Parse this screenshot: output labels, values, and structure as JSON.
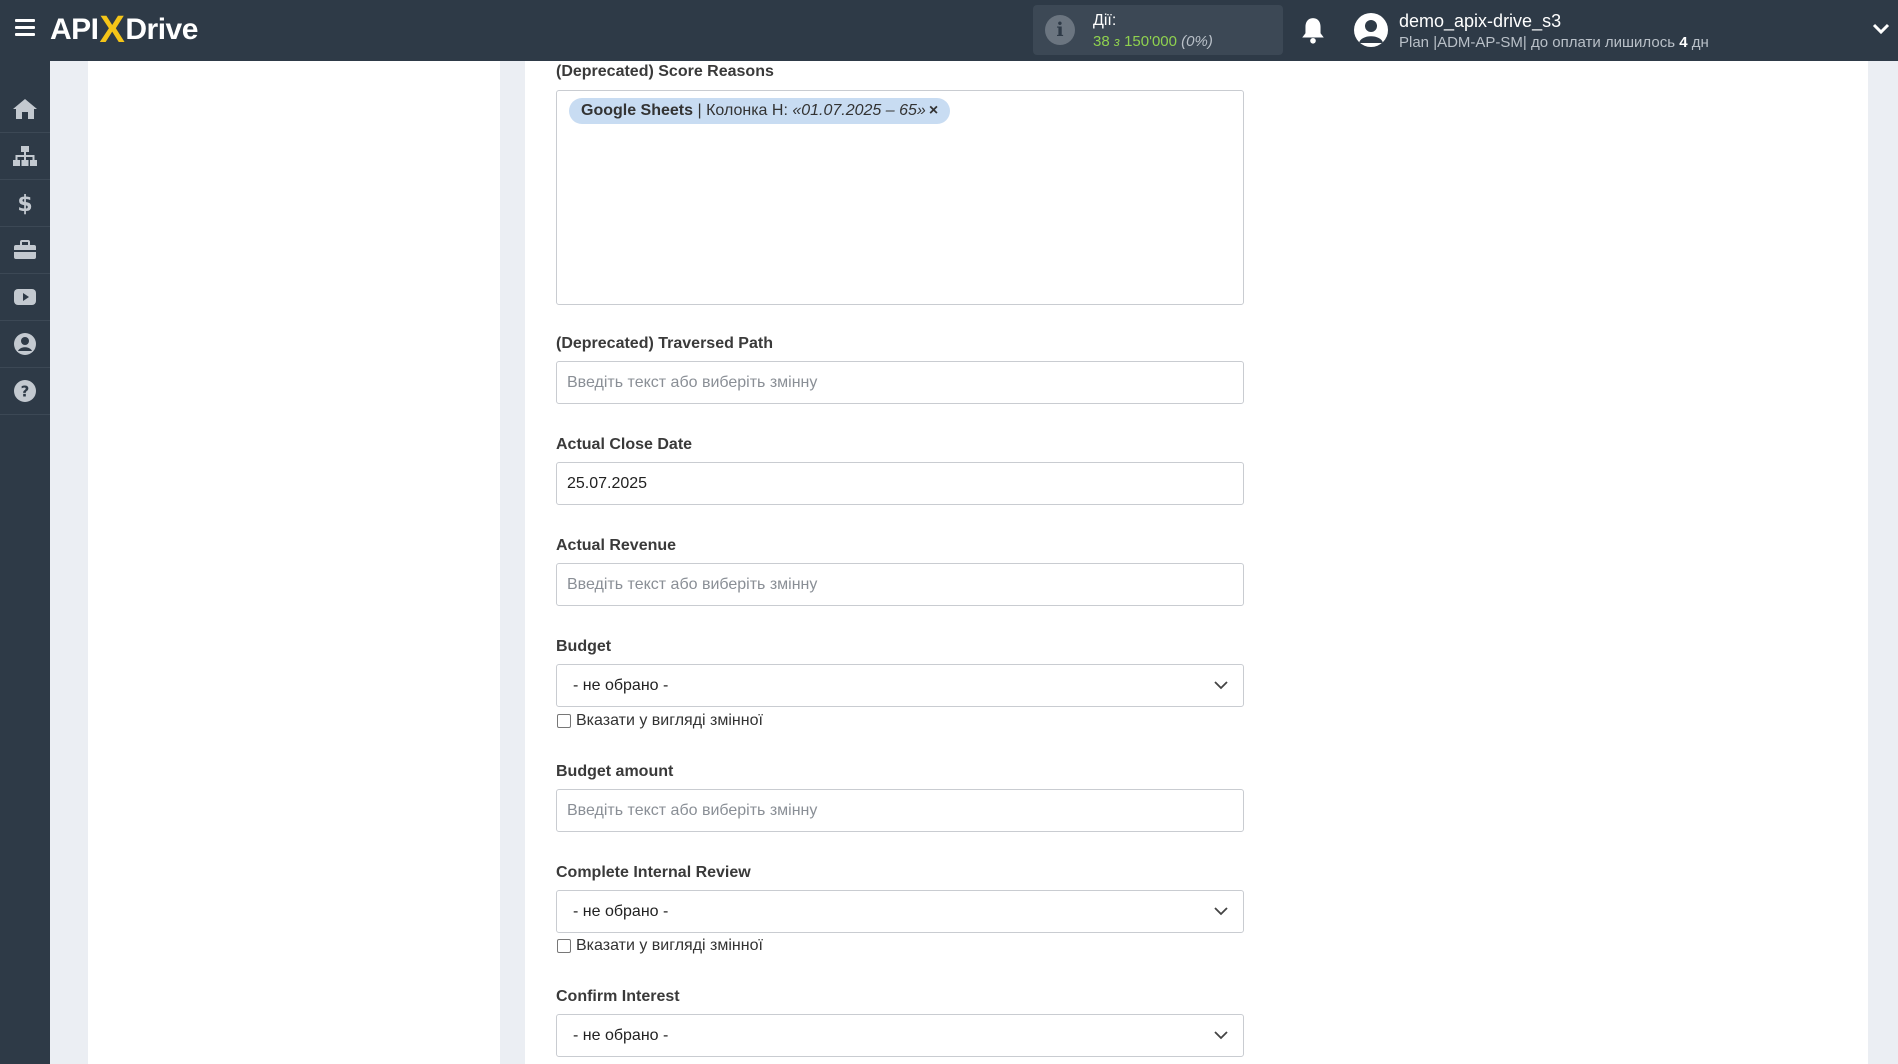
{
  "header": {
    "logo": {
      "left": "API",
      "x": "X",
      "right": "Drive"
    },
    "actions": {
      "label": "Дії:",
      "used": "38",
      "of": "з",
      "limit": "150'000",
      "percent": "(0%)"
    },
    "user": {
      "name": "demo_apix-drive_s3",
      "plan_prefix": "Plan |ADM-AP-SM| до оплати лишилось",
      "days": "4",
      "days_suffix": "дн"
    }
  },
  "sidebar": {
    "items": [
      {
        "icon": "home-icon"
      },
      {
        "icon": "sitemap-icon"
      },
      {
        "icon": "dollar-icon"
      },
      {
        "icon": "briefcase-icon"
      },
      {
        "icon": "youtube-icon"
      },
      {
        "icon": "user-circle-icon"
      },
      {
        "icon": "help-icon"
      }
    ]
  },
  "form": {
    "score_reasons": {
      "label": "(Deprecated) Score Reasons",
      "tag_source": "Google Sheets",
      "tag_separator": " | Колонка H: ",
      "tag_value": "«01.07.2025 – 65»",
      "tag_remove": "×"
    },
    "traversed_path": {
      "label": "(Deprecated) Traversed Path",
      "placeholder": "Введіть текст або виберіть змінну"
    },
    "actual_close_date": {
      "label": "Actual Close Date",
      "value": "25.07.2025"
    },
    "actual_revenue": {
      "label": "Actual Revenue",
      "placeholder": "Введіть текст або виберіть змінну"
    },
    "budget": {
      "label": "Budget",
      "selected": "- не обрано -",
      "checkbox_label": "Вказати у вигляді змінної"
    },
    "budget_amount": {
      "label": "Budget amount",
      "placeholder": "Введіть текст або виберіть змінну"
    },
    "complete_internal_review": {
      "label": "Complete Internal Review",
      "selected": "- не обрано -",
      "checkbox_label": "Вказати у вигляді змінної"
    },
    "confirm_interest": {
      "label": "Confirm Interest",
      "selected": "- не обрано -"
    }
  }
}
